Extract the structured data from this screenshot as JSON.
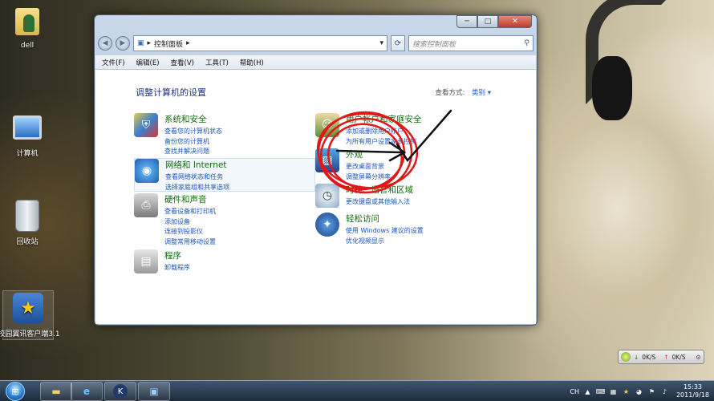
{
  "desktop": {
    "icons": [
      {
        "label": "dell"
      },
      {
        "label": "计算机"
      },
      {
        "label": "回收站"
      },
      {
        "label": "校园翼讯客户端3.1"
      }
    ]
  },
  "window": {
    "breadcrumb": "控制面板",
    "search_placeholder": "搜索控制面板",
    "menu": [
      "文件(F)",
      "编辑(E)",
      "查看(V)",
      "工具(T)",
      "帮助(H)"
    ],
    "title": "调整计算机的设置",
    "view_by_label": "查看方式:",
    "view_by_value": "类别 ▾",
    "categories": [
      {
        "heading": "系统和安全",
        "links": [
          "查看您的计算机状态",
          "备份您的计算机",
          "查找并解决问题"
        ]
      },
      {
        "heading": "网络和 Internet",
        "links": [
          "查看网络状态和任务",
          "选择家庭组和共享选项"
        ]
      },
      {
        "heading": "硬件和声音",
        "links": [
          "查看设备和打印机",
          "添加设备",
          "连接到投影仪",
          "调整常用移动设置"
        ]
      },
      {
        "heading": "程序",
        "links": [
          "卸载程序"
        ]
      },
      {
        "heading": "用户帐户和家庭安全",
        "links": [
          "添加或删除用户帐户",
          "为所有用户设置家长控制"
        ]
      },
      {
        "heading": "外观",
        "links": [
          "更改桌面背景",
          "调整屏幕分辨率"
        ]
      },
      {
        "heading": "时钟、语言和区域",
        "links": [
          "更改键盘或其他输入法"
        ]
      },
      {
        "heading": "轻松访问",
        "links": [
          "使用 Windows 建议的设置",
          "优化视频显示"
        ]
      }
    ]
  },
  "speed_widget": {
    "down": "0K/S",
    "up": "0K/S"
  },
  "taskbar": {
    "lang": "CH",
    "time": "15:33",
    "date": "2011/9/18"
  },
  "colors": {
    "heading_green": "#116a0f",
    "link_blue": "#1a56b8",
    "title_blue": "#1e3287",
    "annotation_red": "#e01818"
  }
}
